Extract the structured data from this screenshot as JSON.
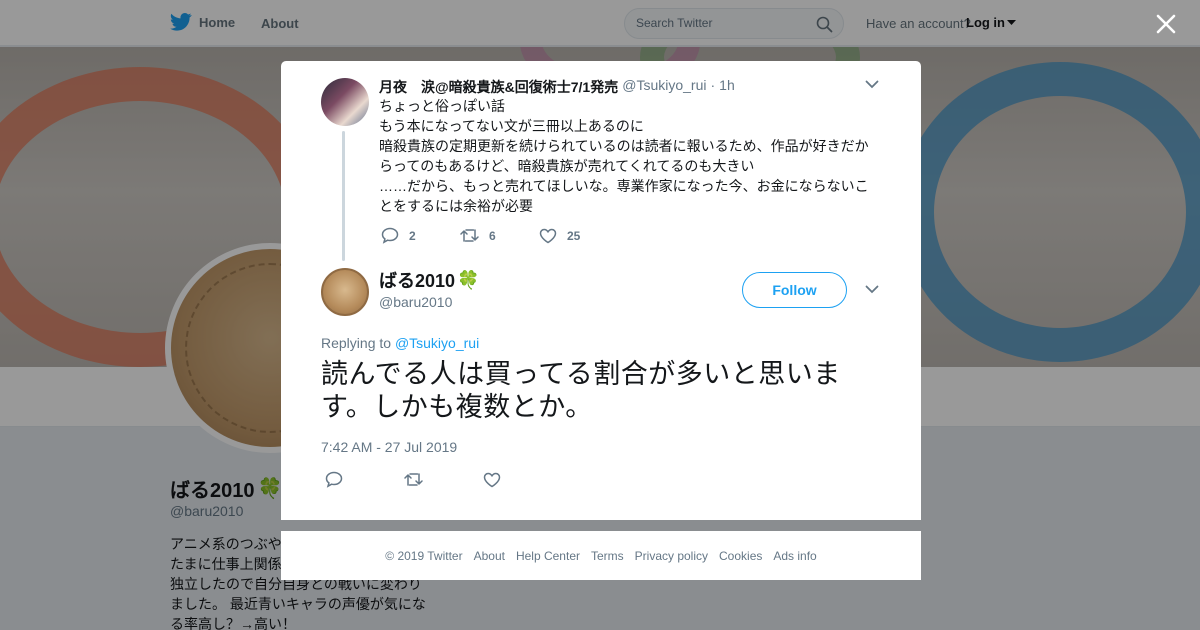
{
  "nav": {
    "home_label": "Home",
    "about_label": "About",
    "search_placeholder": "Search Twitter",
    "have_account_text": "Have an account?",
    "login_label": "Log in"
  },
  "profile": {
    "name": "ばる2010",
    "name_emoji": "🍀",
    "handle": "@baru2010",
    "bio": "アニメ系のつぶやき、\nたまに仕事上関係\n独立したので自分自身との戦いに変わり\nました。 最近青いキャラの声優が気にな\nる率高し？→高い！"
  },
  "ancestor_tweet": {
    "name": "月夜　涙@暗殺貴族&回復術士7/1発売",
    "handle": "@Tsukiyo_rui",
    "separator": "·",
    "time": "1h",
    "text": "ちょっと俗っぽい話\nもう本になってない文が三冊以上あるのに\n暗殺貴族の定期更新を続けられているのは読者に報いるため、作品が好きだからってのもあるけど、暗殺貴族が売れてくれてるのも大きい\n……だから、もっと売れてほしいな。専業作家になった今、お金にならないことをするには余裕が必要",
    "reply_count": "2",
    "retweet_count": "6",
    "like_count": "25"
  },
  "main_tweet": {
    "name": "ばる2010",
    "name_emoji": "🍀",
    "handle": "@baru2010",
    "follow_label": "Follow",
    "replying_prefix": "Replying to",
    "replying_handle": "@Tsukiyo_rui",
    "text": "読んでる人は買ってる割合が多いと思います。しかも複数とか。",
    "timestamp": "7:42 AM - 27 Jul 2019"
  },
  "footer": {
    "copyright": "© 2019 Twitter",
    "links": [
      "About",
      "Help Center",
      "Terms",
      "Privacy policy",
      "Cookies",
      "Ads info"
    ]
  },
  "colors": {
    "brand_blue": "#1da1f2",
    "text_primary": "#14171a",
    "text_secondary": "#657786",
    "overlay": "rgba(0,0,0,0.4)"
  },
  "icons": {
    "logo": "twitter-bird-icon",
    "search": "search-icon",
    "close": "close-icon",
    "reply": "reply-icon",
    "retweet": "retweet-icon",
    "like": "heart-icon",
    "more": "chevron-down-icon",
    "emoji": "four-leaf-clover-icon"
  }
}
